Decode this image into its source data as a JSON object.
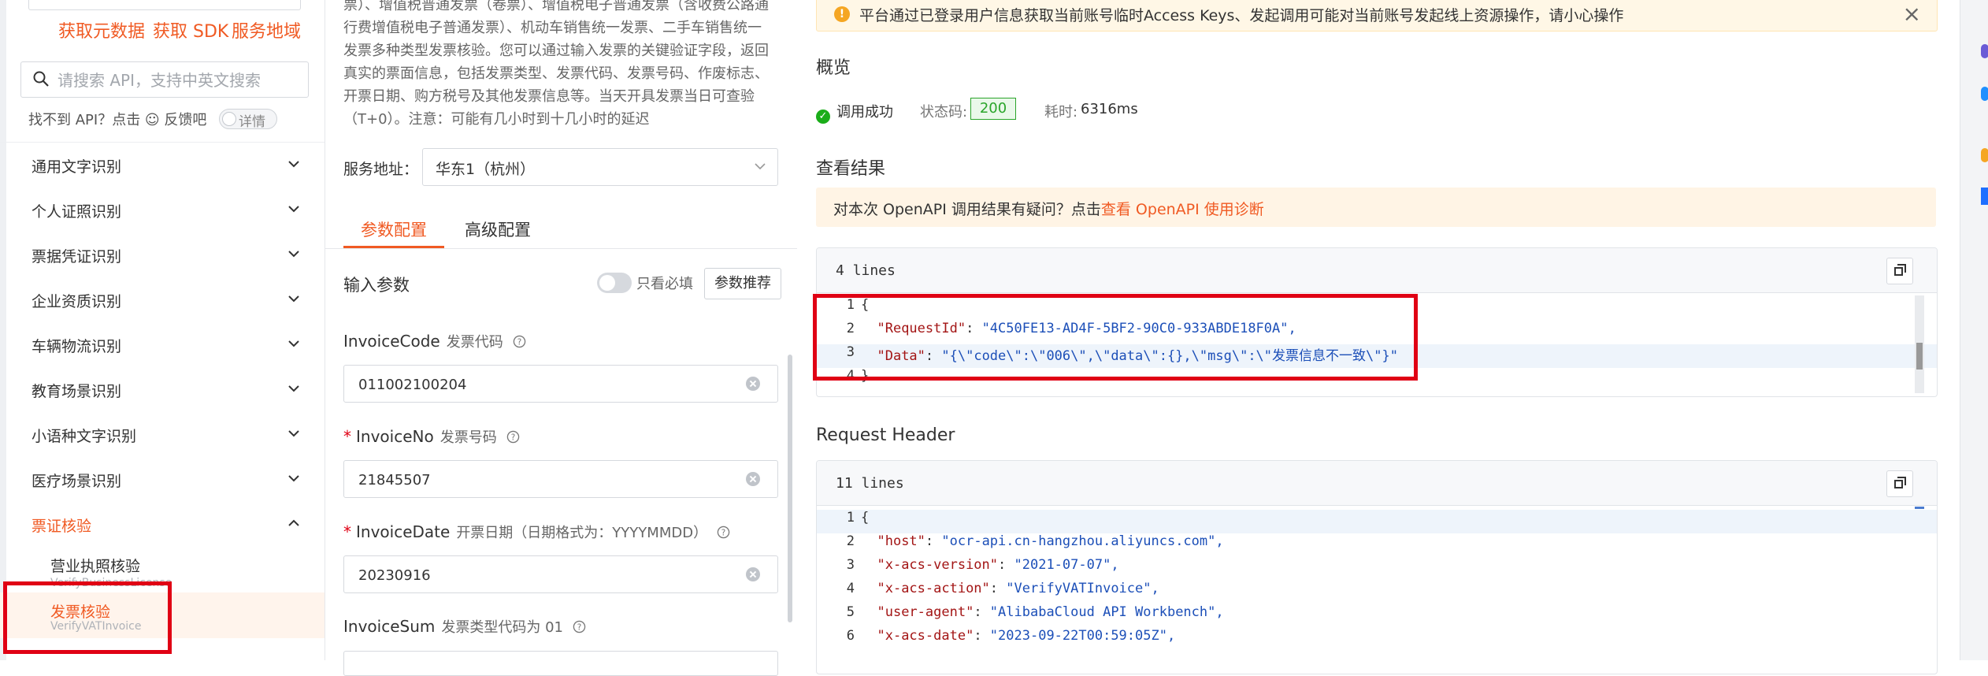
{
  "left": {
    "links": [
      "获取元数据",
      "获取 SDK",
      "服务地域"
    ],
    "search_placeholder": "请搜索 API，支持中英文搜索",
    "hint": "找不到 API？点击 ☺ 反馈吧",
    "detail_toggle": "详情",
    "nav": [
      {
        "label": "通用文字识别"
      },
      {
        "label": "个人证照识别"
      },
      {
        "label": "票据凭证识别"
      },
      {
        "label": "企业资质识别"
      },
      {
        "label": "车辆物流识别"
      },
      {
        "label": "教育场景识别"
      },
      {
        "label": "小语种文字识别"
      },
      {
        "label": "医疗场景识别"
      },
      {
        "label": "票证核验"
      }
    ],
    "sub_items": [
      {
        "name": "营业执照核验",
        "en": "VerifyBusinessLicense"
      },
      {
        "name": "发票核验",
        "en": "VerifyVATInvoice"
      }
    ]
  },
  "mid": {
    "description": "票）、增值税普通发票（卷票）、增值税电子普通发票（含收费公路通行费增值税电子普通发票）、机动车销售统一发票、二手车销售统一发票多种类型发票核验。您可以通过输入发票的关键验证字段，返回真实的票面信息，包括发票类型、发票代码、发票号码、作废标志、开票日期、购方税号及其他发票信息等。当天开具发票当日可查验（T+0）。注意：可能有几小时到十几小时的延迟",
    "service_label": "服务地址：",
    "service_value": "华东1（杭州）",
    "tabs": [
      "参数配置",
      "高级配置"
    ],
    "input_params": "输入参数",
    "only_required": "只看必填",
    "recommend": "参数推荐",
    "params": [
      {
        "name": "InvoiceCode",
        "cn": "发票代码",
        "required": "",
        "value": "011002100204"
      },
      {
        "name": "InvoiceNo",
        "cn": "发票号码",
        "required": "*",
        "value": "21845507"
      },
      {
        "name": "InvoiceDate",
        "cn": "开票日期（日期格式为：YYYYMMDD）",
        "required": "*",
        "value": "20230916"
      },
      {
        "name": "InvoiceSum",
        "cn": "发票类型代码为 01",
        "required": "",
        "value": ""
      }
    ]
  },
  "right": {
    "alert": "平台通过已登录用户信息获取当前账号临时Access Keys、发起调用可能对当前账号发起线上资源操作，请小心操作",
    "overview_title": "概览",
    "status": "调用成功",
    "status_code_label": "状态码:",
    "status_code": "200",
    "time_label": "耗时:",
    "time": "6316ms",
    "result_title": "查看结果",
    "diag_prefix": "对本次 OpenAPI 调用结果有疑问？点击",
    "diag_link": "查看 OpenAPI 使用诊断",
    "result_panel": {
      "lines_label": "4 lines",
      "lines": [
        {
          "n": "1",
          "key": "",
          "val": "{"
        },
        {
          "n": "2",
          "key": "\"RequestId\"",
          "val": "\"4C50FE13-AD4F-5BF2-90C0-933ABDE18F0A\","
        },
        {
          "n": "3",
          "key": "\"Data\"",
          "val": "\"{\\\"code\\\":\\\"006\\\",\\\"data\\\":{},\\\"msg\\\":\\\"发票信息不一致\\\"}\""
        },
        {
          "n": "4",
          "key": "",
          "val": "}"
        }
      ]
    },
    "header_title": "Request Header",
    "header_panel": {
      "lines_label": "11 lines",
      "lines": [
        {
          "n": "1",
          "key": "",
          "val": "{"
        },
        {
          "n": "2",
          "key": "\"host\"",
          "val": "\"ocr-api.cn-hangzhou.aliyuncs.com\","
        },
        {
          "n": "3",
          "key": "\"x-acs-version\"",
          "val": "\"2021-07-07\","
        },
        {
          "n": "4",
          "key": "\"x-acs-action\"",
          "val": "\"VerifyVATInvoice\","
        },
        {
          "n": "5",
          "key": "\"user-agent\"",
          "val": "\"AlibabaCloud API Workbench\","
        },
        {
          "n": "6",
          "key": "\"x-acs-date\"",
          "val": "\"2023-09-22T00:59:05Z\","
        }
      ]
    }
  },
  "colors": {
    "accent": "#f05a23",
    "success": "#1aad19",
    "highlight_box": "#e00014"
  },
  "icons": [
    "search-icon",
    "chevron-down-icon",
    "chevron-up-icon",
    "help-icon",
    "clear-icon",
    "copy-icon",
    "warning-icon",
    "close-icon",
    "success-icon"
  ]
}
